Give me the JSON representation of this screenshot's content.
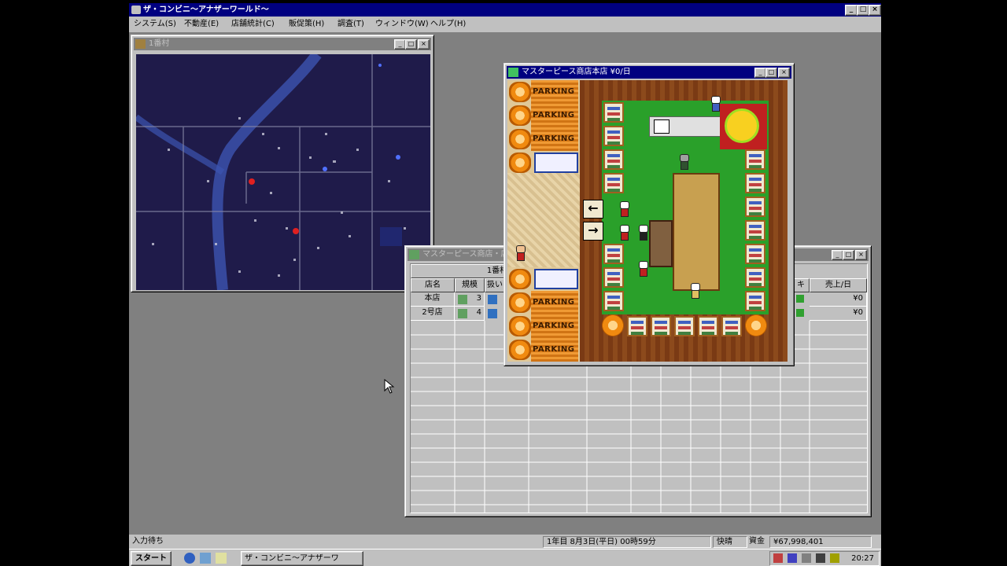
{
  "app": {
    "title": "ザ・コンビニ～アナザーワールド～",
    "menu": [
      "システム(S)",
      "不動産(E)",
      "店舗統計(C)",
      "販促策(H)",
      "調査(T)",
      "ウィンドウ(W)",
      "ヘルプ(H)"
    ]
  },
  "map_window": {
    "title": "1番村"
  },
  "store_window": {
    "title": "マスターピース商店本店 ¥0/日",
    "parking_label": "PARKING",
    "arrow_left": "←",
    "arrow_right": "→"
  },
  "table_window": {
    "title": "マスターピース商店・店舗",
    "group_header": "1番村",
    "columns": [
      "店名",
      "規模",
      "扱い",
      "キ",
      "売上/日"
    ],
    "rows": [
      {
        "name": "本店",
        "size": "3",
        "sales": "¥0"
      },
      {
        "name": "2号店",
        "size": "4",
        "sales": "¥0"
      }
    ]
  },
  "status": {
    "left": "入力待ち",
    "date": "1年目 8月3日(平日) 00時59分",
    "weather": "快晴",
    "funds_label": "資金",
    "funds_value": "¥67,998,401"
  },
  "taskbar": {
    "start_label": "スタート",
    "task_label": "ザ・コンビニ～アナザーワ",
    "clock": "20:27"
  },
  "colors": {
    "title_active": "#000080",
    "title_inactive": "#808080",
    "desktop": "#808080",
    "map_bg": "#1f1b4a",
    "store_floor": "#2aa02a",
    "parking": "#f09a34"
  }
}
